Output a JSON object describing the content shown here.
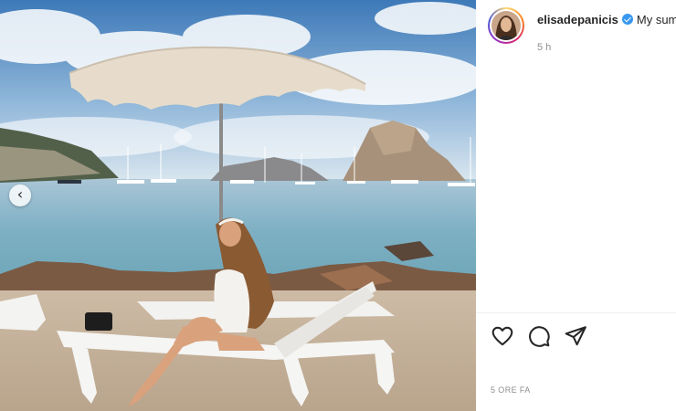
{
  "post": {
    "username": "elisadepanicis",
    "caption_preview": "My sum",
    "time_short": "5 h",
    "time_caps": "5 ORE FA"
  },
  "icons": {
    "verified": "verified-badge-icon",
    "like": "heart-icon",
    "comment": "comment-bubble-icon",
    "share": "paper-plane-icon",
    "prev": "chevron-left-icon"
  },
  "colors": {
    "verified": "#3897f0",
    "text": "#262626",
    "muted": "#8e8e8e"
  },
  "carousel": {
    "prev_glyph": "‹"
  }
}
